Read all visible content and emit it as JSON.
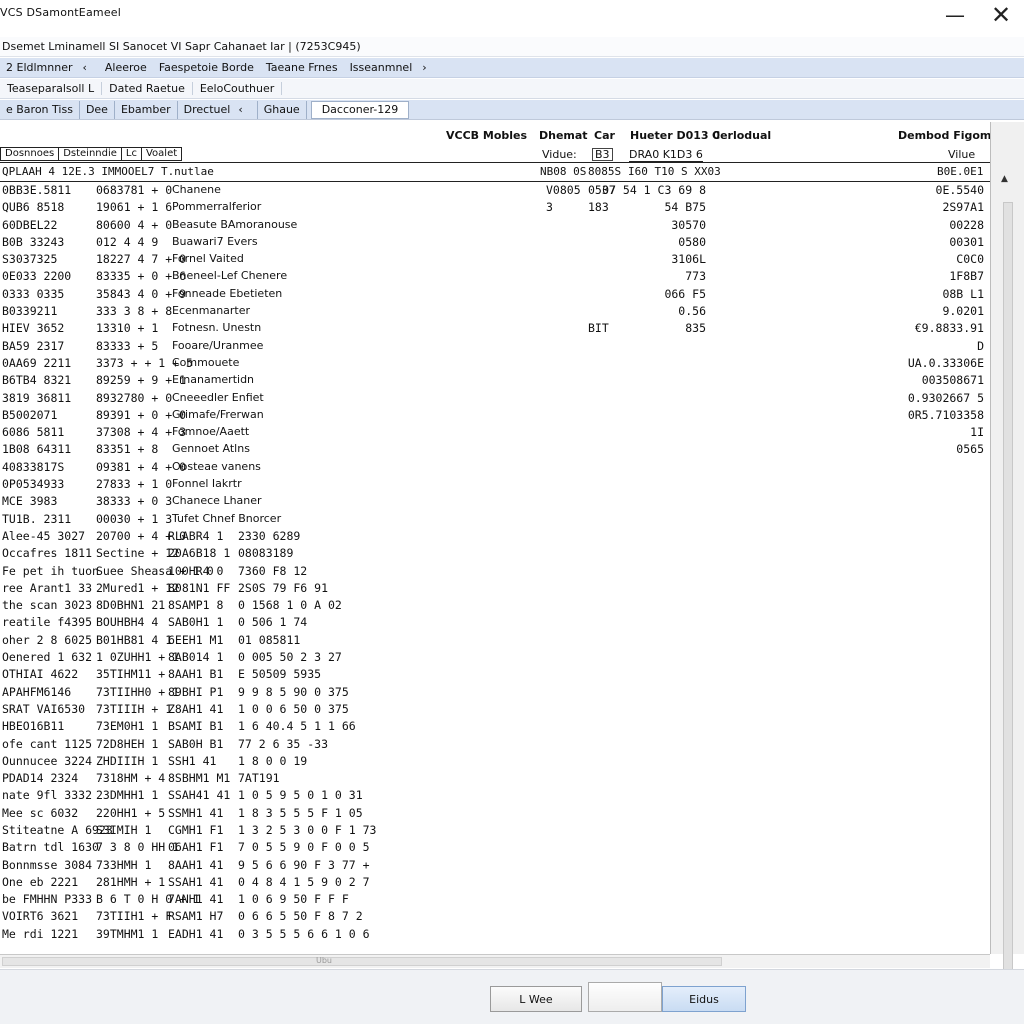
{
  "window": {
    "title": "VCS DSamontEameel",
    "minimize_glyph": "—",
    "close_glyph": "✕"
  },
  "subtitle": "Dsemet Lminamell SI Sanocet VI Sapr Cahanaet Iar | (7253C945)",
  "menubar": {
    "items": [
      "2 Eldlmnner",
      "Aleeroe",
      "Faespetoie Borde",
      "Taeane Frnes",
      "Isseanmnel"
    ],
    "chevron_left": "‹",
    "chevron_right": "›"
  },
  "toolbar2": {
    "items": [
      "Teaseparalsoll L",
      "Dated Raetue",
      "EeloCouthuer"
    ]
  },
  "tabs": {
    "items": [
      "e Baron Tiss",
      "Dee",
      "Ebamber",
      "Drectuel",
      "Ghaue",
      "Dacconer-129"
    ],
    "chevron": "‹"
  },
  "headers": {
    "vccs": "VCCB Mobles",
    "dhemat": "Dhemat",
    "car": "Car",
    "hueter": "Hueter D013 0",
    "corlodual": "Cerlodual",
    "dembod": "Dembod Figom",
    "vidue": "Vidue:",
    "b3": "B3",
    "dra": "DRA0 K1D3 6",
    "vilue": "Vilue"
  },
  "column_box": [
    "Dosnnoes",
    "Dsteinndie",
    "Lc",
    "Voalet"
  ],
  "selected_row": {
    "c1": "QPLAAH 4 12E.3 IMMOOEL7 T.nutlae",
    "c5": "NB08 0S",
    "c6": "8085S",
    "c7": "I60 T10 S XX03",
    "c8": "B0E.0E1",
    "c9": "+ 0"
  },
  "rows": [
    {
      "c1": "0BB3E.5811",
      "c2": "0683781 + 0",
      "c3": "Chanene",
      "c5": "V0805",
      "c6": "0537",
      "c7": "07 54 1 C3 69 8",
      "c8": "0E.5540"
    },
    {
      "c1": "QUB6 8518",
      "c2": "19061 + 1 6",
      "c3": "Pommerralferior",
      "c5": "3",
      "c6": "183",
      "c7": "54 B75",
      "c8": "2S97A1"
    },
    {
      "c1": "60DBEL22",
      "c2": "80600 4 + 0",
      "c3": "Beasute BAmoranouse",
      "c5": "",
      "c6": "",
      "c7": "30570",
      "c8": "00228"
    },
    {
      "c1": "B0B 33243",
      "c2": "012 4 4 9",
      "c3": "Buawari7 Evers",
      "c5": "",
      "c6": "",
      "c7": "0580",
      "c8": "00301"
    },
    {
      "c1": "S3037325",
      "c2": "18227 4 7 + 0",
      "c3": "Fornel Vaited",
      "c5": "",
      "c6": "",
      "c7": "3106L",
      "c8": "C0C0"
    },
    {
      "c1": "0E033 2200",
      "c2": "83335 + 0 + 6",
      "c3": "Bneneel-Lef Chenere",
      "c5": "",
      "c6": "",
      "c7": "773",
      "c8": "1F8B7"
    },
    {
      "c1": "0333 0335",
      "c2": "35843 4 0 + 9",
      "c3": "Fonneade Ebetieten",
      "c5": "",
      "c6": "",
      "c7": "066 F5",
      "c8": "08B L1"
    },
    {
      "c1": "B0339211",
      "c2": "333 3 8 + 8",
      "c3": "Ecenmanarter",
      "c5": "",
      "c6": "",
      "c7": "0.56",
      "c8": "9.0201"
    },
    {
      "c1": "HIEV 3652",
      "c2": "13310 + 1",
      "c3": "Fotnesn. Unestn",
      "c5": "",
      "c6": "BIT",
      "c7": "835",
      "c8": "€9.8833.91"
    },
    {
      "c1": "BA59 2317",
      "c2": "83333 + 5",
      "c3": "Fooare/Uranmee",
      "c5": "",
      "c6": "",
      "c7": "",
      "c8": "D"
    },
    {
      "c1": "0AA69 2211",
      "c2": "3373 + + 1 + 5",
      "c3": "Commouete",
      "c5": "",
      "c6": "",
      "c7": "",
      "c8": "UA.0.33306E"
    },
    {
      "c1": "B6TB4 8321",
      "c2": "89259 + 9 + 1",
      "c3": "Ernanamertidn",
      "c5": "",
      "c6": "",
      "c7": "",
      "c8": "003508671"
    },
    {
      "c1": "3819 36811",
      "c2": "8932780 + 0",
      "c3": "Cneeedler Enfiet",
      "c5": "",
      "c6": "",
      "c7": "",
      "c8": "0.9302667 5"
    },
    {
      "c1": "B5002071",
      "c2": "89391 + 0 + 0",
      "c3": "Grimafe/Frerwan",
      "c5": "",
      "c6": "",
      "c7": "",
      "c8": "0R5.7103358"
    },
    {
      "c1": "6086 5811",
      "c2": "37308 + 4 + 3",
      "c3": "Fomnoe/Aaett",
      "c5": "",
      "c6": "",
      "c7": "",
      "c8": "1I"
    },
    {
      "c1": "1B08 64311",
      "c2": "83351 + 8",
      "c3": "Gennoet Atlns",
      "c5": "",
      "c6": "",
      "c7": "",
      "c8": "0565"
    },
    {
      "c1": "40833817S",
      "c2": "09381 + 4 + 0",
      "c3": "Oosteae vanens",
      "c5": "",
      "c6": "",
      "c7": "",
      "c8": ""
    },
    {
      "c1": "0P0534933",
      "c2": "27833 + 1 0",
      "c3": "Fonnel Iakrtr",
      "c5": "",
      "c6": "",
      "c7": "",
      "c8": ""
    },
    {
      "c1": "MCE 3983",
      "c2": "38333 + 0 3",
      "c3": "Chanece Lhaner",
      "c5": "",
      "c6": "",
      "c7": "",
      "c8": ""
    },
    {
      "c1": "TU1B. 2311",
      "c2": "00030 + 1 3",
      "c3": "Tufet Chnef Bnorcer",
      "c5": "",
      "c6": "",
      "c7": "",
      "c8": ""
    },
    {
      "c1": "Alee-45 3027",
      "c2": "20700 + 4 + 0",
      "c4": "RLABR4 1",
      "c4b": "2330 6289",
      "mono": true
    },
    {
      "c1": "Occafres 1811",
      "c2": "Sectine + 12",
      "c4": "20A6B18 1",
      "c4b": "08083189",
      "mono": true
    },
    {
      "c1": "Fe pet ih tuon",
      "c2": "Suee Sheasa + 1 0",
      "c4": "100HR4 0",
      "c4b": "7360 F8 12",
      "mono": true
    },
    {
      "c1": "ree Arant1 33",
      "c2": "2Mured1 + 12",
      "c4": "8081N1 FF",
      "c4b": "2S0S 79 F6 91",
      "mono": true
    },
    {
      "c1": "the scan 3023",
      "c2": "8D0BHN1 21",
      "c4": "8SAMP1 8",
      "c4b": "0 1568 1 0 A 02",
      "mono": true
    },
    {
      "c1": "reatile f4395",
      "c2": "BOUHBH4 4",
      "c4": "SAB0H1 1",
      "c4b": "0 506 1 74",
      "mono": true
    },
    {
      "c1": "oher 2 8 6025",
      "c2": "B01HB81 4 1",
      "c4": "6EEH1 M1",
      "c4b": "01 085811",
      "mono": true
    },
    {
      "c1": "Oenered 1 632",
      "c2": "1 0ZUHH1 + 1",
      "c4": "8AB014 1",
      "c4b": "0 005 50 2 3 27",
      "mono": true
    },
    {
      "c1": "OTHIAI 4622",
      "c2": "35TIHM11 +",
      "c4": "8AAH1 B1",
      "c4b": "E 50509 5935",
      "mono": true
    },
    {
      "c1": "APAHFM6146",
      "c2": "73TIIHH0 + 1",
      "c4": "89BHI P1",
      "c4b": "9 9 8 5 90 0 375",
      "mono": true
    },
    {
      "c1": "SRAT VAI6530",
      "c2": "73TIIIH + 1",
      "c4": "Z8AH1 41",
      "c4b": "1 0 0 6 50 0 375",
      "mono": true
    },
    {
      "c1": "HBEO16B11",
      "c2": "73EM0H1 1",
      "c4": "BSAMI B1",
      "c4b": "1 6 40.4 5 1 1 66",
      "mono": true
    },
    {
      "c1": "ofe cant 1125",
      "c2": "72D8HEH 1",
      "c4": "SAB0H B1",
      "c4b": "77 2 6 35 -33",
      "mono": true
    },
    {
      "c1": "Ounnucee 3224",
      "c2": "ZHDIIIH 1",
      "c4": "SSH1 41",
      "c4b": "1 8 0 0 19",
      "mono": true
    },
    {
      "c1": "PDAD14 2324",
      "c2": "7318HM + 4",
      "c4": "8SBHM1 M1",
      "c4b": "7AT191",
      "mono": true
    },
    {
      "c1": "nate 9fl 3332",
      "c2": "23DMHH1 1",
      "c4": "SSAH41 41",
      "c4b": "1 0 5 9 5 0 1 0 31",
      "mono": true
    },
    {
      "c1": "Mee sc 6032",
      "c2": "220HH1 + 5",
      "c4": "SSMH1 41",
      "c4b": "1 8 3 5 5 5 F 1 05",
      "mono": true
    },
    {
      "c1": "Stiteatne A 6923",
      "c2": "S3IMIH 1",
      "c4": "CGMH1 F1",
      "c4b": "1 3 2 5 3 0 0 F 1 73",
      "mono": true
    },
    {
      "c1": "Batrn tdl 1630",
      "c2": "7 3 8 0 HH 1",
      "c4": "06AH1 F1",
      "c4b": "7 0 5 5 9 0 F 0 0 5",
      "mono": true
    },
    {
      "c1": "Bonnmsse 3084",
      "c2": "733HMH 1",
      "c4": "8AAH1 41",
      "c4b": "9 5 6 6 90 F 3 77 +",
      "mono": true
    },
    {
      "c1": "One eb 2221",
      "c2": "281HMH + 1",
      "c4": "SSAH1 41",
      "c4b": "0 4 8 4 1 5 9 0 2 7",
      "mono": true
    },
    {
      "c1": "be FMHHN P333",
      "c2": "B 6 T 0 H 0 + 1",
      "c4": "7ANH1 41",
      "c4b": "1 0 6 9 50 F F F",
      "mono": true
    },
    {
      "c1": "VOIRT6 3621",
      "c2": "73TIIH1 + F",
      "c4": "RSAM1 H7",
      "c4b": "0 6 6 5 50 F 8 7 2",
      "mono": true
    },
    {
      "c1": "Me rdi 1221",
      "c2": "39TMHM1 1",
      "c4": "EADH1 41",
      "c4b": "0 3 5 5 5 6 6 1 0 6",
      "mono": true
    }
  ],
  "hscroll_label": "Ubu",
  "vscroll": {
    "up": "▲",
    "down": "▼"
  },
  "footer": {
    "view_label": "L Wee",
    "exit_label": "Eidus"
  }
}
